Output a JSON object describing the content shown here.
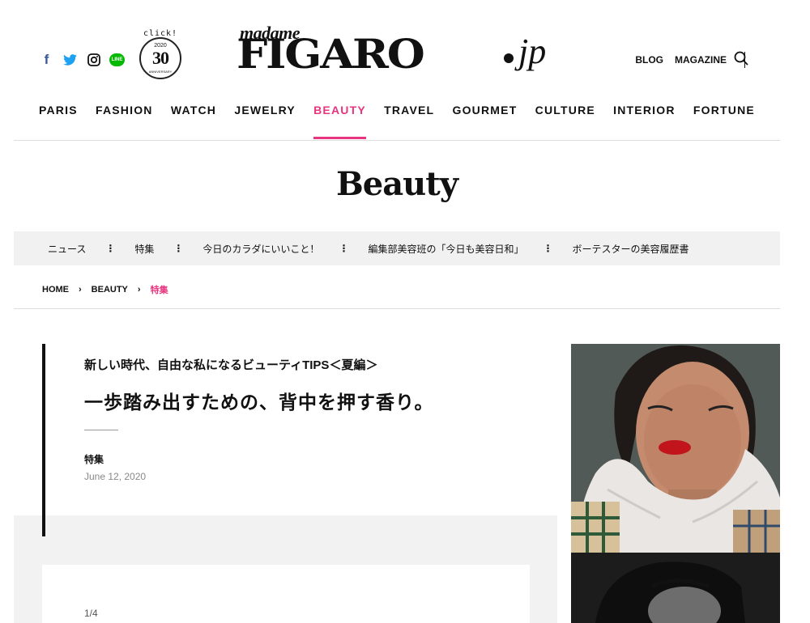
{
  "header": {
    "social": [
      {
        "name": "facebook-icon",
        "glyph": "f"
      },
      {
        "name": "twitter-icon"
      },
      {
        "name": "instagram-icon"
      },
      {
        "name": "line-icon",
        "glyph": "LINE"
      }
    ],
    "badge": {
      "click": "click!",
      "year": "2020",
      "number": "30",
      "caption": "ANNIVERSARY"
    },
    "logo": {
      "madame": "madame",
      "main": "FIGARO",
      "suffix": "jp"
    },
    "links": {
      "blog": "BLOG",
      "magazine": "MAGAZINE"
    }
  },
  "nav": {
    "items": [
      "PARIS",
      "FASHION",
      "WATCH",
      "JEWELRY",
      "BEAUTY",
      "TRAVEL",
      "GOURMET",
      "CULTURE",
      "INTERIOR",
      "FORTUNE"
    ],
    "active": "BEAUTY"
  },
  "section": {
    "title": "Beauty"
  },
  "subnav": {
    "items": [
      "ニュース",
      "特集",
      "今日のカラダにいいこと！",
      "編集部美容班の「今日も美容日和」",
      "ボーテスターの美容履歴書"
    ],
    "separator": "⋮"
  },
  "breadcrumb": {
    "home": "HOME",
    "section": "BEAUTY",
    "current": "特集",
    "separator": "›"
  },
  "article": {
    "kicker": "新しい時代、自由な私になるビューティTIPS＜夏編＞",
    "headline": "一歩踏み出すための、背中を押す香り。",
    "category": "特集",
    "date": "June 12, 2020",
    "pager": "1/4"
  },
  "colors": {
    "accent": "#e8357f",
    "text": "#111111",
    "subnav_bg": "#f1f1f1",
    "facebook": "#3b5998",
    "twitter": "#1da1f2",
    "line": "#00b900"
  }
}
